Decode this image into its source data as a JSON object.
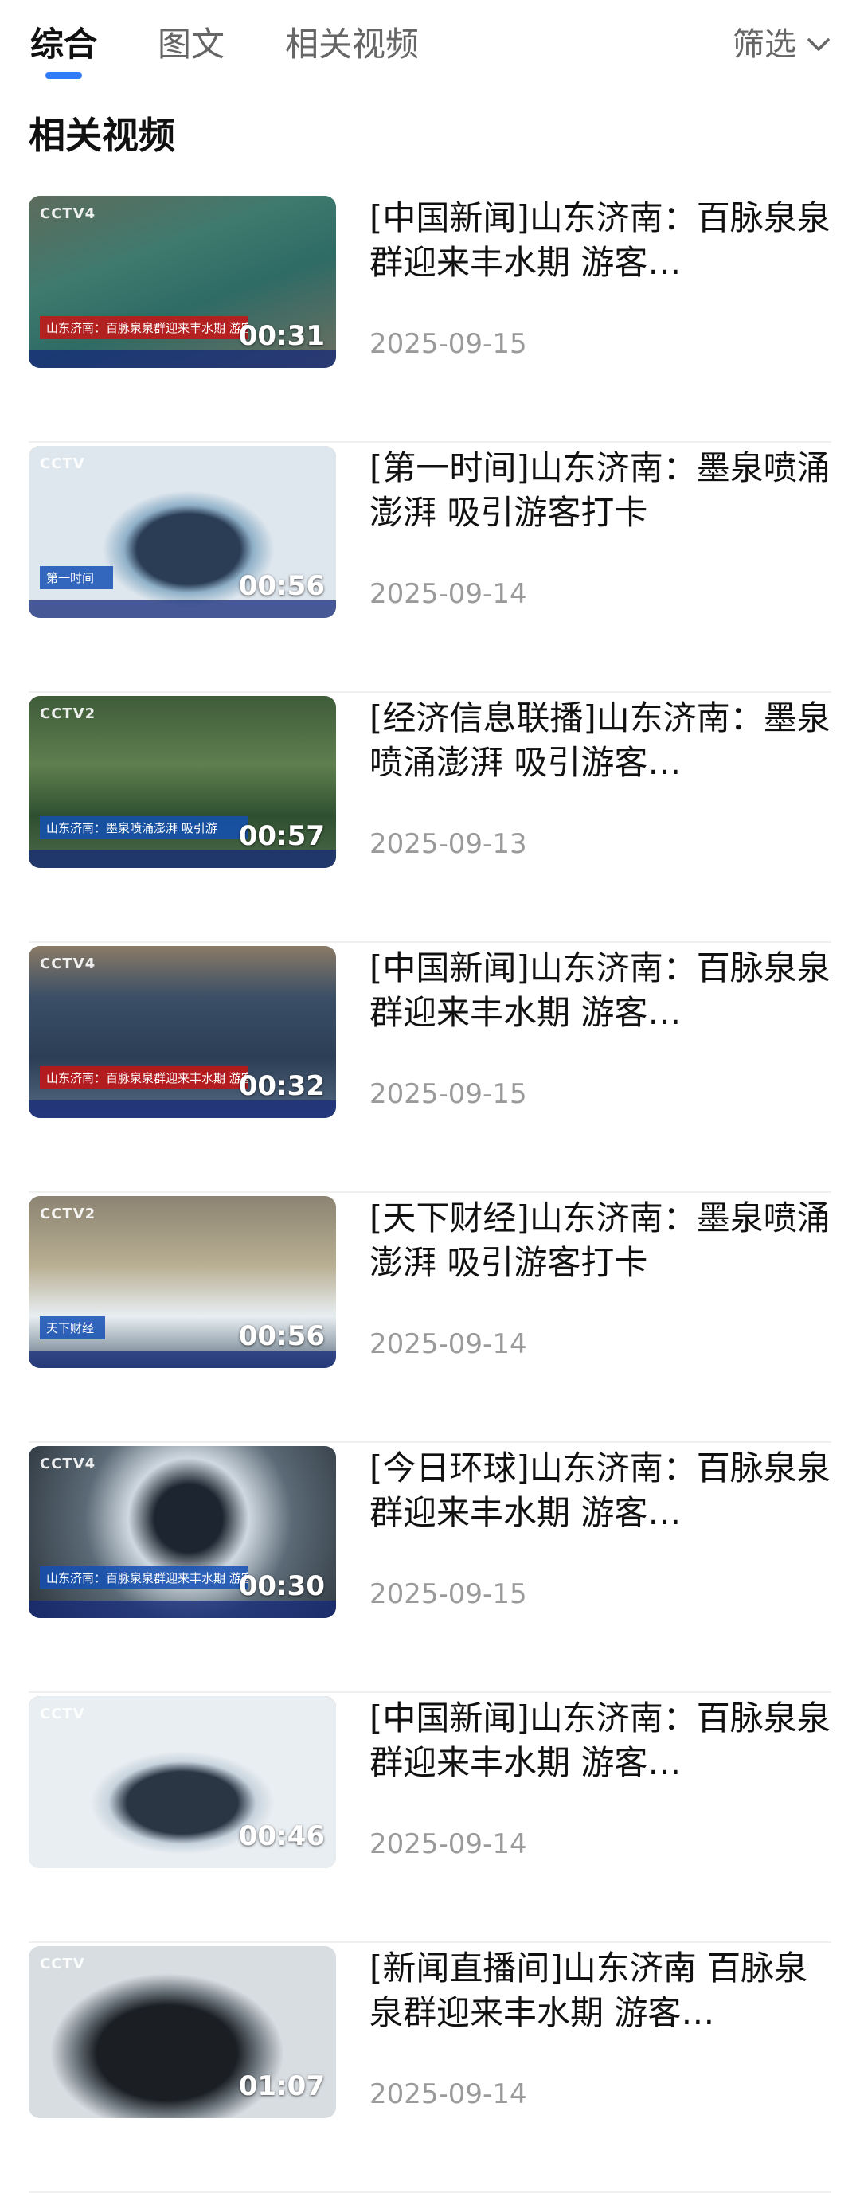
{
  "tabs": {
    "items": [
      {
        "label": "综合"
      },
      {
        "label": "图文"
      },
      {
        "label": "相关视频"
      }
    ],
    "filter_label": "筛选"
  },
  "section": {
    "title": "相关视频"
  },
  "videos": [
    {
      "title": "[中国新闻]山东济南：百脉泉泉群迎来丰水期 游客…",
      "date": "2025-09-15",
      "duration": "00:31",
      "thumb_caption": "山东济南：百脉泉泉群迎来丰水期 游客打卡"
    },
    {
      "title": "[第一时间]山东济南：墨泉喷涌澎湃 吸引游客打卡",
      "date": "2025-09-14",
      "duration": "00:56",
      "thumb_caption": "第一时间"
    },
    {
      "title": "[经济信息联播]山东济南：墨泉喷涌澎湃 吸引游客…",
      "date": "2025-09-13",
      "duration": "00:57",
      "thumb_caption": "山东济南：墨泉喷涌澎湃 吸引游"
    },
    {
      "title": "[中国新闻]山东济南：百脉泉泉群迎来丰水期 游客…",
      "date": "2025-09-15",
      "duration": "00:32",
      "thumb_caption": "山东济南：百脉泉泉群迎来丰水期 游客打卡"
    },
    {
      "title": "[天下财经]山东济南：墨泉喷涌澎湃 吸引游客打卡",
      "date": "2025-09-14",
      "duration": "00:56",
      "thumb_caption": "天下财经"
    },
    {
      "title": "[今日环球]山东济南：百脉泉泉群迎来丰水期 游客…",
      "date": "2025-09-15",
      "duration": "00:30",
      "thumb_caption": "山东济南：百脉泉泉群迎来丰水期 游客打卡"
    },
    {
      "title": "[中国新闻]山东济南：百脉泉泉群迎来丰水期 游客…",
      "date": "2025-09-14",
      "duration": "00:46",
      "thumb_caption": ""
    },
    {
      "title": "[新闻直播间]山东济南 百脉泉泉群迎来丰水期 游客…",
      "date": "2025-09-14",
      "duration": "01:07",
      "thumb_caption": ""
    }
  ],
  "colors": {
    "accent": "#2f7cf6",
    "date_text": "#9a9a9a"
  }
}
